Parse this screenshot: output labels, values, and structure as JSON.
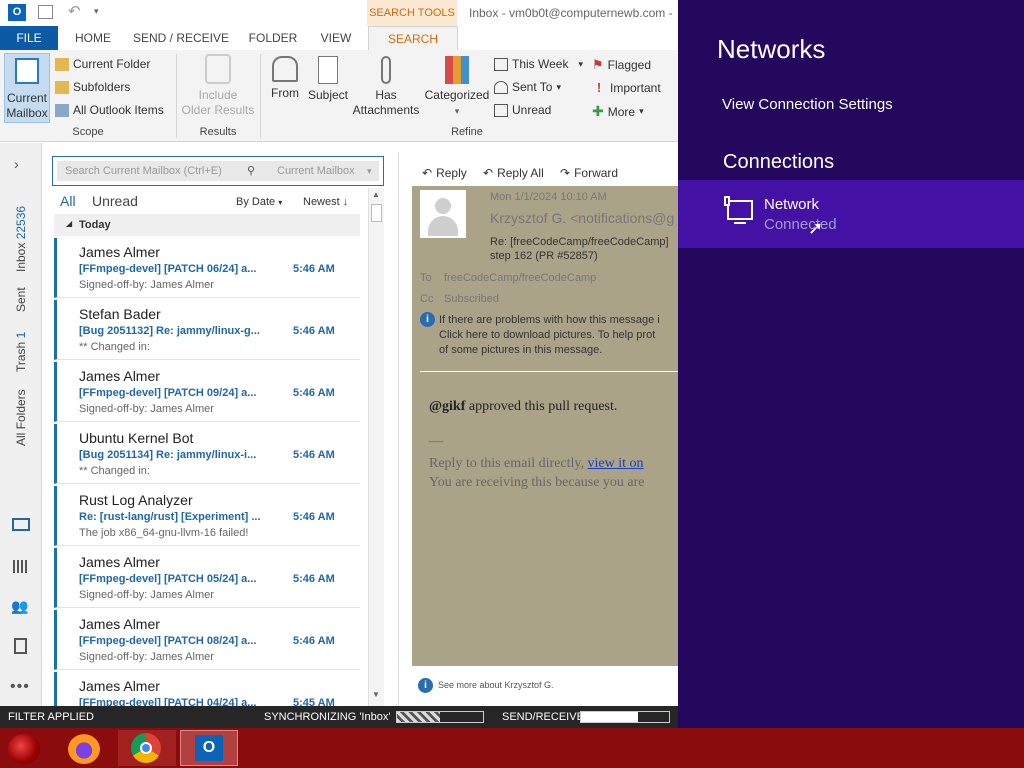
{
  "titlebar": {
    "app_title": "Inbox - vm0b0t@computernewb.com -",
    "context_tab": "SEARCH TOOLS"
  },
  "tabs": [
    "FILE",
    "HOME",
    "SEND / RECEIVE",
    "FOLDER",
    "VIEW",
    "SEARCH"
  ],
  "ribbon": {
    "current_mailbox": [
      "Current",
      "Mailbox"
    ],
    "current_folder": "Current Folder",
    "subfolders": "Subfolders",
    "all_outlook_items": "All Outlook Items",
    "scope_label": "Scope",
    "include_older": [
      "Include",
      "Older Results"
    ],
    "results_label": "Results",
    "from": "From",
    "subject": "Subject",
    "has_attachments": [
      "Has",
      "Attachments"
    ],
    "categorized": "Categorized",
    "this_week": "This Week",
    "sent_to": "Sent To",
    "unread": "Unread",
    "flagged": "Flagged",
    "important": "Important",
    "more": "More",
    "refine_label": "Refine"
  },
  "leftnav": {
    "inbox": "Inbox",
    "inbox_count": "22536",
    "sent": "Sent",
    "trash": "Trash",
    "trash_count": "1",
    "all_folders": "All Folders"
  },
  "search": {
    "placeholder": "Search Current Mailbox (Ctrl+E)",
    "scope": "Current Mailbox"
  },
  "list": {
    "all": "All",
    "unread": "Unread",
    "by_date": "By Date",
    "newest": "Newest",
    "today": "Today",
    "items": [
      {
        "sender": "James Almer",
        "subject": "[FFmpeg-devel] [PATCH 06/24] a...",
        "time": "5:46 AM",
        "preview": "Signed-off-by: James Almer"
      },
      {
        "sender": "Stefan Bader",
        "subject": "[Bug 2051132] Re: jammy/linux-g...",
        "time": "5:46 AM",
        "preview": "** Changed in:"
      },
      {
        "sender": "James Almer",
        "subject": "[FFmpeg-devel] [PATCH 09/24] a...",
        "time": "5:46 AM",
        "preview": "Signed-off-by: James Almer"
      },
      {
        "sender": "Ubuntu Kernel Bot",
        "subject": "[Bug 2051134] Re: jammy/linux-i...",
        "time": "5:46 AM",
        "preview": "** Changed in:"
      },
      {
        "sender": "Rust Log Analyzer",
        "subject": "Re: [rust-lang/rust] [Experiment] ...",
        "time": "5:46 AM",
        "preview": "The job x86_64-gnu-llvm-16 failed!"
      },
      {
        "sender": "James Almer",
        "subject": "[FFmpeg-devel] [PATCH 05/24] a...",
        "time": "5:46 AM",
        "preview": "Signed-off-by: James Almer"
      },
      {
        "sender": "James Almer",
        "subject": "[FFmpeg-devel] [PATCH 08/24] a...",
        "time": "5:46 AM",
        "preview": "Signed-off-by: James Almer"
      },
      {
        "sender": "James Almer",
        "subject": "[FFmpeg-devel] [PATCH 04/24] a...",
        "time": "5:45 AM",
        "preview": ""
      }
    ]
  },
  "reading": {
    "reply": "Reply",
    "reply_all": "Reply All",
    "forward": "Forward",
    "date": "Mon 1/1/2024 10:10 AM",
    "from": "Krzysztof G. <notifications@g",
    "subject_line1": "Re: [freeCodeCamp/freeCodeCamp]",
    "subject_line2": "step 162 (PR #52857)",
    "to_label": "To",
    "to_value": "freeCodeCamp/freeCodeCamp",
    "cc_label": "Cc",
    "cc_value": "Subscribed",
    "info_line1": "If there are problems with how this message i",
    "info_line2": "Click here to download pictures. To help prot",
    "info_line3": "of some pictures in this message.",
    "body_user": "@gikf",
    "body_text": " approved this pull request.",
    "dash": "—",
    "reply_line": "Reply to this email directly, ",
    "view_link": "view it on",
    "receiving_line": "You are receiving this because you are",
    "see_more": "See more about Krzysztof G."
  },
  "status": {
    "filter": "FILTER APPLIED",
    "sync": "SYNCHRONIZING 'Inbox'",
    "sendreceive": "SEND/RECEIVE",
    "sync_progress": 0.5,
    "send_progress": 0.65
  },
  "network": {
    "title": "Networks",
    "view_settings": "View Connection Settings",
    "connections": "Connections",
    "network_name": "Network",
    "network_status": "Connected"
  },
  "colors": {
    "accent_blue": "#2167a8",
    "charm_bg": "#24085e",
    "charm_selected": "#4312a5",
    "taskbar": "#8b0c0c"
  }
}
